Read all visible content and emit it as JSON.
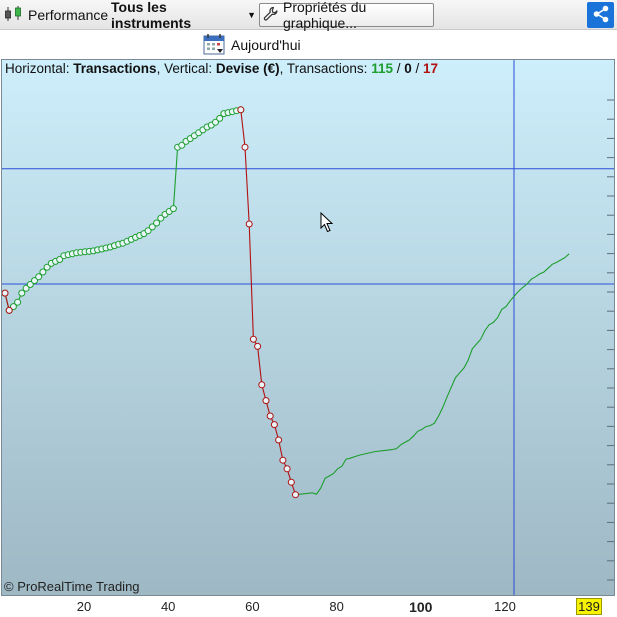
{
  "toolbar": {
    "performance_label": "Performance",
    "instruments_label": "Tous les instruments",
    "properties_label": "Propriétés du graphique..."
  },
  "today": {
    "label": "Aujourd'hui"
  },
  "header": {
    "h_prefix": "Horizontal: ",
    "h_value": "Transactions",
    "v_prefix": ", Vertical: ",
    "v_value": "Devise (€)",
    "t_prefix": ", Transactions: ",
    "wins": "115",
    "sep1": " / ",
    "neutral": "0",
    "sep2": " / ",
    "losses": "17"
  },
  "watermark": "© ProRealTime Trading",
  "colors": {
    "win": "#1d9e2e",
    "loss": "#b01212",
    "crosshair": "#2a4ed8",
    "bg_top": "#cdeefb",
    "bg_bottom": "#9eb8c4",
    "share": "#1a73d9",
    "badge": "#f7f200"
  },
  "icons": {
    "performance": "candlestick-icon",
    "instruments": "dropdown-arrow-icon",
    "properties": "wrench-icon",
    "share": "share-icon",
    "today": "calendar-icon"
  },
  "chart_data": {
    "type": "line",
    "xlabel": "Transactions",
    "ylabel": "Devise (€)",
    "xlim": [
      1,
      139
    ],
    "x_ticks": [
      20,
      40,
      60,
      80,
      100,
      120
    ],
    "x_tick_labels": [
      "20",
      "40",
      "60",
      "80",
      "100",
      "120"
    ],
    "last_label": "139",
    "crosshair": {
      "x": 121.9,
      "y_levels": [
        0.815,
        0.575
      ]
    },
    "series": [
      {
        "color": "#1d9e2e",
        "markers": true,
        "points": [
          [
            1,
            0.556
          ],
          [
            2,
            0.52
          ],
          [
            3,
            0.528
          ],
          [
            4,
            0.537
          ],
          [
            5,
            0.556
          ],
          [
            6,
            0.566
          ],
          [
            7,
            0.574
          ],
          [
            8,
            0.582
          ],
          [
            9,
            0.59
          ],
          [
            10,
            0.6
          ],
          [
            11,
            0.61
          ],
          [
            12,
            0.618
          ],
          [
            13,
            0.622
          ],
          [
            14,
            0.626
          ],
          [
            15,
            0.634
          ],
          [
            16,
            0.636
          ],
          [
            17,
            0.638
          ],
          [
            18,
            0.64
          ],
          [
            19,
            0.641
          ],
          [
            20,
            0.642
          ],
          [
            21,
            0.643
          ],
          [
            22,
            0.644
          ],
          [
            23,
            0.646
          ],
          [
            24,
            0.648
          ],
          [
            25,
            0.65
          ],
          [
            26,
            0.652
          ],
          [
            27,
            0.655
          ],
          [
            28,
            0.658
          ],
          [
            29,
            0.66
          ],
          [
            30,
            0.664
          ],
          [
            31,
            0.668
          ],
          [
            32,
            0.672
          ],
          [
            33,
            0.676
          ],
          [
            34,
            0.68
          ],
          [
            35,
            0.686
          ],
          [
            36,
            0.694
          ],
          [
            37,
            0.702
          ],
          [
            38,
            0.712
          ],
          [
            39,
            0.72
          ],
          [
            40,
            0.726
          ],
          [
            41,
            0.732
          ],
          [
            42,
            0.86
          ],
          [
            43,
            0.864
          ],
          [
            44,
            0.872
          ],
          [
            45,
            0.878
          ],
          [
            46,
            0.884
          ],
          [
            47,
            0.89
          ],
          [
            48,
            0.896
          ],
          [
            49,
            0.902
          ],
          [
            50,
            0.906
          ],
          [
            51,
            0.912
          ],
          [
            52,
            0.92
          ],
          [
            53,
            0.93
          ],
          [
            54,
            0.932
          ],
          [
            55,
            0.934
          ],
          [
            56,
            0.936
          ],
          [
            57,
            0.938
          ]
        ]
      },
      {
        "color": "#b01212",
        "markers": true,
        "points": [
          [
            1,
            0.556
          ],
          [
            2,
            0.52
          ],
          [
            57,
            0.938
          ],
          [
            58,
            0.86
          ],
          [
            59,
            0.7
          ],
          [
            60,
            0.46
          ],
          [
            61,
            0.445
          ],
          [
            62,
            0.365
          ],
          [
            63,
            0.332
          ],
          [
            64,
            0.3
          ],
          [
            65,
            0.282
          ],
          [
            66,
            0.25
          ],
          [
            67,
            0.208
          ],
          [
            68,
            0.19
          ],
          [
            69,
            0.162
          ],
          [
            70,
            0.136
          ]
        ]
      },
      {
        "color": "#1d9e2e",
        "markers": false,
        "points": [
          [
            70,
            0.136
          ],
          [
            72,
            0.138
          ],
          [
            74,
            0.14
          ],
          [
            75,
            0.137
          ],
          [
            76,
            0.15
          ],
          [
            77,
            0.17
          ],
          [
            78,
            0.175
          ],
          [
            79,
            0.18
          ],
          [
            80,
            0.19
          ],
          [
            81,
            0.195
          ],
          [
            82,
            0.21
          ],
          [
            83,
            0.212
          ],
          [
            85,
            0.218
          ],
          [
            87,
            0.222
          ],
          [
            89,
            0.226
          ],
          [
            91,
            0.228
          ],
          [
            93,
            0.23
          ],
          [
            94,
            0.232
          ],
          [
            95,
            0.24
          ],
          [
            96,
            0.245
          ],
          [
            97,
            0.25
          ],
          [
            98,
            0.258
          ],
          [
            99,
            0.268
          ],
          [
            100,
            0.272
          ],
          [
            101,
            0.278
          ],
          [
            102,
            0.28
          ],
          [
            103,
            0.285
          ],
          [
            104,
            0.3
          ],
          [
            105,
            0.318
          ],
          [
            106,
            0.34
          ],
          [
            107,
            0.36
          ],
          [
            108,
            0.38
          ],
          [
            109,
            0.39
          ],
          [
            110,
            0.4
          ],
          [
            111,
            0.416
          ],
          [
            112,
            0.44
          ],
          [
            113,
            0.45
          ],
          [
            114,
            0.46
          ],
          [
            115,
            0.478
          ],
          [
            116,
            0.49
          ],
          [
            117,
            0.495
          ],
          [
            118,
            0.505
          ],
          [
            119,
            0.522
          ],
          [
            120,
            0.528
          ],
          [
            121,
            0.54
          ],
          [
            122,
            0.55
          ],
          [
            123,
            0.56
          ],
          [
            124,
            0.568
          ],
          [
            125,
            0.575
          ],
          [
            126,
            0.585
          ],
          [
            127,
            0.59
          ],
          [
            128,
            0.596
          ],
          [
            129,
            0.6
          ],
          [
            130,
            0.608
          ],
          [
            131,
            0.616
          ],
          [
            132,
            0.62
          ],
          [
            133,
            0.625
          ],
          [
            134,
            0.63
          ],
          [
            135,
            0.638
          ]
        ]
      }
    ]
  }
}
